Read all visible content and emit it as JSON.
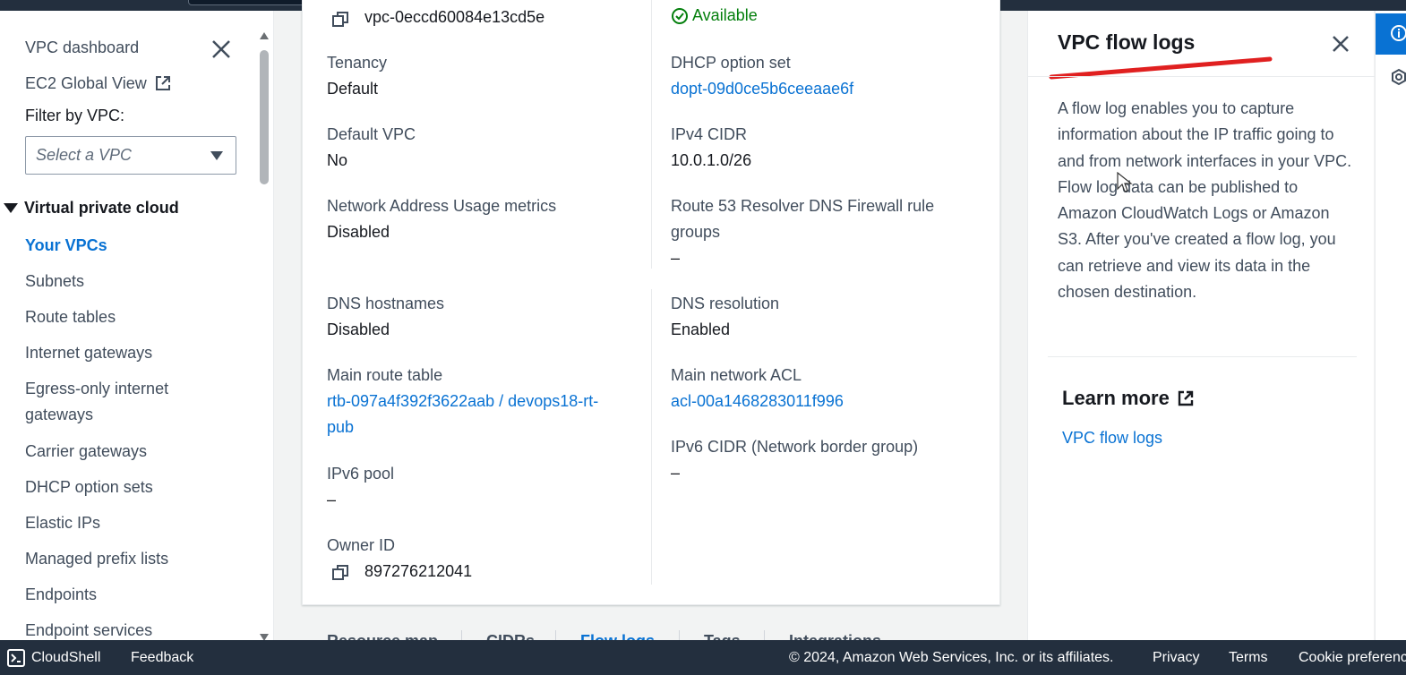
{
  "sidebar": {
    "vpc_dashboard": "VPC dashboard",
    "ec2_global_view": "EC2 Global View",
    "filter_label": "Filter by VPC:",
    "filter_placeholder": "Select a VPC",
    "section_title": "Virtual private cloud",
    "items": [
      {
        "label": "Your VPCs",
        "active": true
      },
      {
        "label": "Subnets"
      },
      {
        "label": "Route tables"
      },
      {
        "label": "Internet gateways"
      },
      {
        "label": "Egress-only internet"
      },
      {
        "label": "gateways"
      },
      {
        "label": "Carrier gateways"
      },
      {
        "label": "DHCP option sets"
      },
      {
        "label": "Elastic IPs"
      },
      {
        "label": "Managed prefix lists"
      },
      {
        "label": "Endpoints"
      },
      {
        "label": "Endpoint services"
      }
    ]
  },
  "details": {
    "vpc_id": "vpc-0eccd60084e13cd5e",
    "state": "Available",
    "tenancy_label": "Tenancy",
    "tenancy_value": "Default",
    "dhcp_label": "DHCP option set",
    "dhcp_value": "dopt-09d0ce5b6ceeaae6f",
    "default_vpc_label": "Default VPC",
    "default_vpc_value": "No",
    "ipv4_label": "IPv4 CIDR",
    "ipv4_value": "10.0.1.0/26",
    "nau_label": "Network Address Usage metrics",
    "nau_value": "Disabled",
    "r53_label_line1": "Route 53 Resolver DNS Firewall rule",
    "r53_label_line2": "groups",
    "r53_value": "–",
    "dns_hostnames_label": "DNS hostnames",
    "dns_hostnames_value": "Disabled",
    "dns_resolution_label": "DNS resolution",
    "dns_resolution_value": "Enabled",
    "main_rt_label": "Main route table",
    "main_rt_line1": "rtb-097a4f392f3622aab / devops18-rt-",
    "main_rt_line2": "pub",
    "main_acl_label": "Main network ACL",
    "main_acl_value": "acl-00a1468283011f996",
    "ipv6_cidr_label": "IPv6 CIDR (Network border group)",
    "ipv6_cidr_value": "–",
    "ipv6_pool_label": "IPv6 pool",
    "ipv6_pool_value": "–",
    "owner_label": "Owner ID",
    "owner_value": "897276212041"
  },
  "tabs": [
    "Resource map",
    "CIDRs",
    "Flow logs",
    "Tags",
    "Integrations"
  ],
  "help": {
    "title": "VPC flow logs",
    "body": "A flow log enables you to capture information about the IP traffic going to and from network interfaces in your VPC. Flow log data can be published to Amazon CloudWatch Logs or Amazon S3. After you've created a flow log, you can retrieve and view its data in the chosen destination.",
    "learn_more": "Learn more",
    "link": "VPC flow logs"
  },
  "footer": {
    "cloudshell": "CloudShell",
    "feedback": "Feedback",
    "copyright": "© 2024, Amazon Web Services, Inc. or its affiliates.",
    "privacy": "Privacy",
    "terms": "Terms",
    "cookies": "Cookie preferences"
  },
  "colors": {
    "link": "#0972d3",
    "success": "#037f0c",
    "header": "#232f3e",
    "annotation": "#e02020"
  }
}
